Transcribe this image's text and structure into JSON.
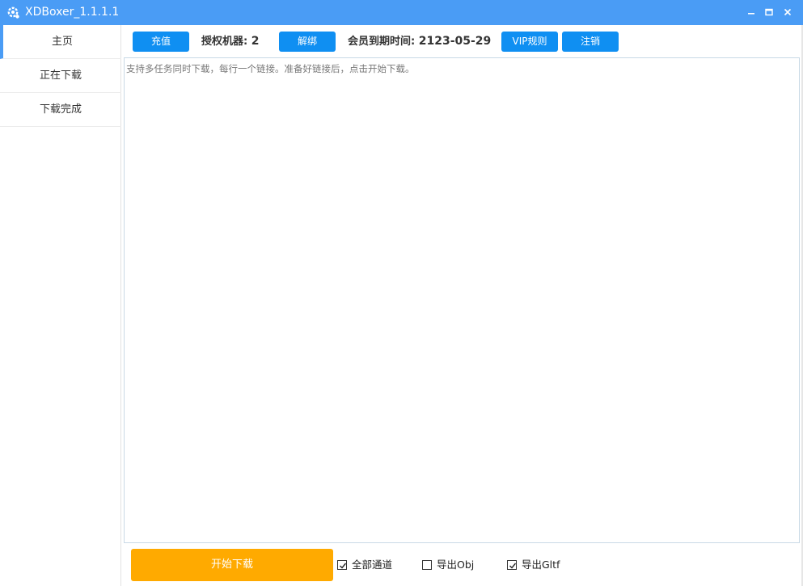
{
  "window": {
    "title": "XDBoxer_1.1.1.1",
    "icons": {
      "app": "gear-icon",
      "minimize": "minimize-icon",
      "maximize": "maximize-icon",
      "close": "close-icon"
    },
    "colors": {
      "titlebar": "#4a9cf5"
    }
  },
  "sidebar": {
    "items": [
      {
        "label": "主页",
        "active": true
      },
      {
        "label": "正在下载",
        "active": false
      },
      {
        "label": "下载完成",
        "active": false
      }
    ]
  },
  "toolbar": {
    "recharge_label": "充值",
    "devices_label": "授权机器:",
    "devices_value": "2",
    "unbind_label": "解绑",
    "expire_label": "会员到期时间:",
    "expire_value": "2123-05-29",
    "vip_label": "VIP规则",
    "logout_label": "注销",
    "colors": {
      "button": "#0f8ff2"
    }
  },
  "main": {
    "links_placeholder": "支持多任务同时下载，每行一个链接。准备好链接后，点击开始下载。",
    "links_value": ""
  },
  "footer": {
    "start_label": "开始下载",
    "options": [
      {
        "label": "全部通道",
        "checked": true
      },
      {
        "label": "导出Obj",
        "checked": false
      },
      {
        "label": "导出Gltf",
        "checked": true
      }
    ],
    "colors": {
      "start_button": "#ffaa00"
    }
  }
}
